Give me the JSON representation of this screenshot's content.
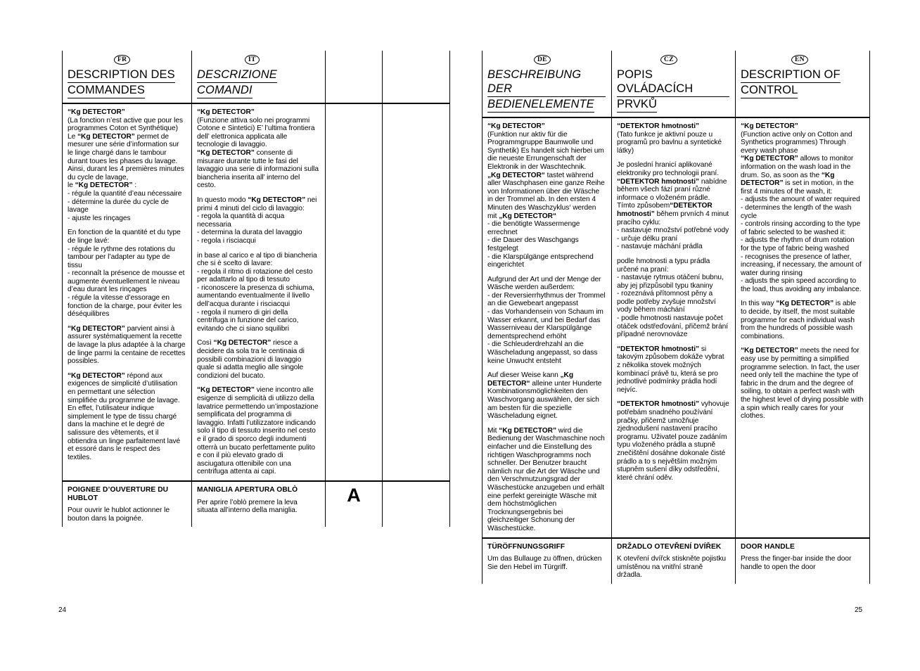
{
  "document": {
    "page_left_number": "24",
    "page_right_number": "25"
  },
  "left_page": {
    "columns": [
      {
        "flag": "FR",
        "title_line1": "DESCRIPTION DES",
        "title_line2": "COMMANDES",
        "italic": false,
        "body": {
          "heading": "“Kg DETECTOR”",
          "p1_a": "(La fonction n’est active que pour les programmes Coton et Synthétique)",
          "p1_b_pre": "Le ",
          "p1_b_bold": "“Kg DETECTOR”",
          "p1_b_post": " permet de mesurer une série d’information sur le linge chargé dans le tambour durant toues les phases du lavage.",
          "p1_c": "Ainsi, durant les 4 premières minutes du cycle de lavage,",
          "p1_d_pre": "le ",
          "p1_d_bold": "“Kg DETECTOR”",
          "p1_d_post": " :",
          "bullets1": [
            "- régule la quantité d’eau nécessaire",
            "- détermine la durée du cycle de lavage",
            "- ajuste les rinçages"
          ],
          "p2_intro": "En fonction de la quantité et du type de linge lavé:",
          "bullets2": [
            "- régule le rythme des rotations du tambour per l’adapter au type de tissu",
            "- reconnaît la présence de mousse et augmente éventuellement le niveau d’eau durant les rinçages",
            "- régule la vitesse d’essorage en fonction de la charge, pour éviter les déséquilibres"
          ],
          "p3_bold": "“Kg DETECTOR”",
          "p3_post": " parvient ainsi à assurer systématiquement la recette de lavage la plus adaptée à la charge de linge parmi la centaine de recettes possibles.",
          "p4_bold": "“Kg DETECTOR”",
          "p4_post": " répond aux exigences de simplicité d’utilisation en permettant une sélection simplifiée du programme de lavage. En effet, l’utilisateur indique simplement le type de tissu chargé dans la machine et le degré de salissure des vêtements, et il obtiendra un linge parfaitement lavé et essoré dans le respect des textiles."
        },
        "footer": {
          "heading": "POIGNEE D’OUVERTURE DU HUBLOT",
          "text": "Pour ouvrir le hublot actionner le bouton dans la poignée."
        }
      },
      {
        "flag": "IT",
        "title_line1": "DESCRIZIONE",
        "title_line2": "COMANDI",
        "italic": true,
        "body": {
          "heading": "“Kg DETECTOR”",
          "p1_a": "(Funzione attiva solo nei programmi Cotone e Sintetici) E’ l’ultima frontiera dell’ elettronica applicata alle tecnologie di lavaggio.",
          "p1_b_pre": " ",
          "p1_b_bold": "“Kg DETECTOR”",
          "p1_b_post": " consente di misurare durante tutte le fasi del lavaggio una serie di informazioni sulla biancheria inserita all’ interno del cesto.",
          "p2_pre": "In questo modo ",
          "p2_bold": "“Kg DETECTOR”",
          "p2_post": " nei primi 4 minuti del ciclo di lavaggio:",
          "bullets1": [
            "- regola la quantità di acqua necessaria",
            "- determina la durata del lavaggio",
            "- regola i risciacqui"
          ],
          "p3_intro": "in base al carico e al tipo di biancheria che si è scelto di lavare:",
          "bullets2": [
            "- regola il ritmo di rotazione del cesto per adattarlo al tipo di tessuto",
            "- riconoscere la presenza di schiuma, aumentando eventualmente il livello dell’acqua durante i risciacqui",
            "- regola il numero di giri della centrifuga in funzione del carico, evitando che ci siano squilibri"
          ],
          "p4_pre": "Così ",
          "p4_bold": "“Kg DETECTOR”",
          "p4_post": " riesce a decidere da sola tra le centinaia di possibili combinazioni di lavaggio quale si adatta meglio alle singole condizioni del bucato.",
          "p5_bold": "“Kg DETECTOR”",
          "p5_post": " viene incontro alle esigenze di semplicità di utilizzo della lavatrice permettendo un’impostazione semplificata del programma di lavaggio. Infatti l’utilizzatore indicando solo il tipo di tessuto inserito nel cesto e il grado di sporco degli indumenti otterrà un bucato perfettamente pulito e con il più elevato grado di asciugatura ottenibile con una centrifuga attenta ai capi."
        },
        "footer": {
          "heading": "MANIGLIA APERTURA OBLÒ",
          "text": "Per aprire l’oblò premere la leva situata all’interno della maniglia."
        }
      },
      {
        "flag": "",
        "title_line1": "",
        "title_line2": "",
        "footer_mark": "A"
      },
      {
        "flag": "",
        "title_line1": "",
        "title_line2": "",
        "footer_mark": ""
      }
    ]
  },
  "right_page": {
    "columns": [
      {
        "flag": "DE",
        "title_line1": "BESCHREIBUNG DER",
        "title_line2": "BEDIENELEMENTE",
        "italic": true,
        "body": {
          "heading": "“Kg DETECTOR”",
          "p1_a": "(Funktion nur aktiv für die Programmgruppe Baumwolle und Synthetik) Es handelt sich hierbei um die neueste Errungenschaft der Elektronik in der Waschtechnik.",
          "p1_b_bold": "„Kg DETECTOR“",
          "p1_b_post": " tastet während aller Waschphasen eine ganze Reihe von Informationen über die Wäsche in der Trommel ab. In den ersten 4 Minuten des Waschzyklus‘ werden mit ",
          "p1_b_bold2": "„Kg DETECTOR“",
          "bullets1": [
            "- die benötigte Wassermenge errechnet",
            "- die Dauer des Waschgangs festgelegt",
            "- die Klarspülgänge entsprechend eingerichtet"
          ],
          "p2_intro": "Aufgrund der Art und der Menge der Wäsche werden außerdem:",
          "bullets2": [
            "- der Reversierrhythmus der Trommel an die Gewebeart angepasst",
            "- das Vorhandensein von Schaum im Wasser erkannt, und bei Bedarf das Wasserniveau der Klarspülgänge dementsprechend erhöht",
            "- die Schleuderdrehzahl an die Wäscheladung angepasst, so dass keine Unwucht entsteht"
          ],
          "p3_pre": "Auf dieser Weise kann ",
          "p3_bold": "„Kg DETECTOR“",
          "p3_post": " alleine unter Hunderte Kombinationsmöglichkeiten den Waschvorgang auswählen, der sich am besten für die spezielle Wäscheladung eignet.",
          "p4_pre": "Mit ",
          "p4_bold": "“Kg DETECTOR”",
          "p4_post": " wird die Bedienung der Waschmaschine noch einfacher und die Einstellung des richtigen Waschprogramms noch schneller. Der Benutzer braucht nämlich nur die Art der Wäsche und den Verschmutzungsgrad der Wäschestücke anzugeben und erhält eine perfekt gereinigte Wäsche mit dem höchstmöglichen Trocknungsergebnis bei gleichzeitiger Schonung der Wäschestücke."
        },
        "footer": {
          "heading": "TÜRÖFFNUNGSGRIFF",
          "text": "Um das Bullauge zu öffnen, drücken Sie den Hebel im Türgriff."
        }
      },
      {
        "flag": "CZ",
        "title_line1": "POPIS OVLÁDACÍCH",
        "title_line2": "PRVKŮ",
        "italic": false,
        "body": {
          "heading": "“DETEKTOR hmotnosti”",
          "p1_a": "(Tato funkce je aktivní pouze u programů pro bavlnu a syntetické látky)",
          "p1_c": "Je poslední hranicí aplikované elektroniky pro technologii praní.",
          "p1_b_bold": "“DETEKTOR hmotnosti”",
          "p1_b_post": " nabídne během všech fází praní různé informace o vloženém prádle.",
          "p2_pre": "Tímto způsobem",
          "p2_bold": "“DETEKTOR hmotnosti”",
          "p2_post": " během prvních 4 minut pracího cyklu:",
          "bullets1": [
            "- nastavuje množství potřebné vody",
            "- určuje délku praní",
            "- nastavuje máchání prádla"
          ],
          "p3_intro": "podle hmotnosti a typu prádla určené na praní:",
          "bullets2": [
            "- nastavuje rytmus otáčení bubnu, aby jej přizpůsobil typu tkaniny",
            "- rozeznává přítomnost pěny a podle potřeby zvyšuje množství vody během máchání",
            "- podle hmotnosti nastavuje počet otáček odstřeďování, přičemž brání případné nerovnováze"
          ],
          "p4_bold": "“DETEKTOR hmotnosti”",
          "p4_post": " si takovým způsobem dokáže vybrat z několika stovek možných kombinací právě tu, která se pro jednotlivé podmínky prádla hodí nejvíc.",
          "p5_bold": "“DETEKTOR hmotnosti”",
          "p5_post": " vyhovuje potřebám snadného používání pračky, přičemž umožňuje zjednodušení nastavení pracího programu. Uživatel pouze zadáním typu vloženého prádla a stupně znečištění dosáhne dokonale čisté prádlo a to s největším možným stupněm sušení díky odstředění, které chrání oděv."
        },
        "footer": {
          "heading": "DRŽADLO OTEVŘENÍ DVÍŘEK",
          "text": "K otevření dvířck stiskněte pojistku umístěnou na vnitřní straně držadla."
        }
      },
      {
        "flag": "EN",
        "title_line1": "DESCRIPTION OF",
        "title_line2": "CONTROL",
        "italic": false,
        "body": {
          "heading": "“Kg DETECTOR”",
          "p1_a": "(Function active only on Cotton and Synthetics programmes) Through every wash phase",
          "p1_b_bold": "“Kg DETECTOR”",
          "p1_b_post": " allows  to monitor information on the wash load in the drum. So, as soon as the ",
          "p1_b_bold2": "“Kg DETECTOR”",
          "p1_b_post2": " is set in motion, in the first 4 minutes of the wash, it:",
          "bullets1": [
            "- adjusts the amount of water required",
            "- determines the length of the wash cycle",
            "- controls rinsing according to the type of fabric selected to be washed it:",
            "- adjusts the rhythm of drum rotation for the type of fabric being washed",
            "- recognises the presence of lather, increasing, if necessary, the amount of water during rinsing",
            "- adjusts the spin speed according to the load, thus avoiding any imbalance."
          ],
          "p3_pre": "In this way ",
          "p3_bold": "“Kg DETECTOR”",
          "p3_post": " is able to decide, by itself, the most suitable programme for each individual wash from the hundreds of possible wash combinations.",
          "p4_bold": "“Kg DETECTOR”",
          "p4_post": " meets the need for easy use by permitting a simplified programme selection. In fact, the user need only tell the machine the type of fabric in the drum and the degree of soiling, to obtain a perfect wash with the highest level of drying possible with a spin which really cares for your clothes."
        },
        "footer": {
          "heading": "DOOR HANDLE",
          "text": "Press the finger-bar inside the door handle to open the door"
        }
      }
    ]
  }
}
